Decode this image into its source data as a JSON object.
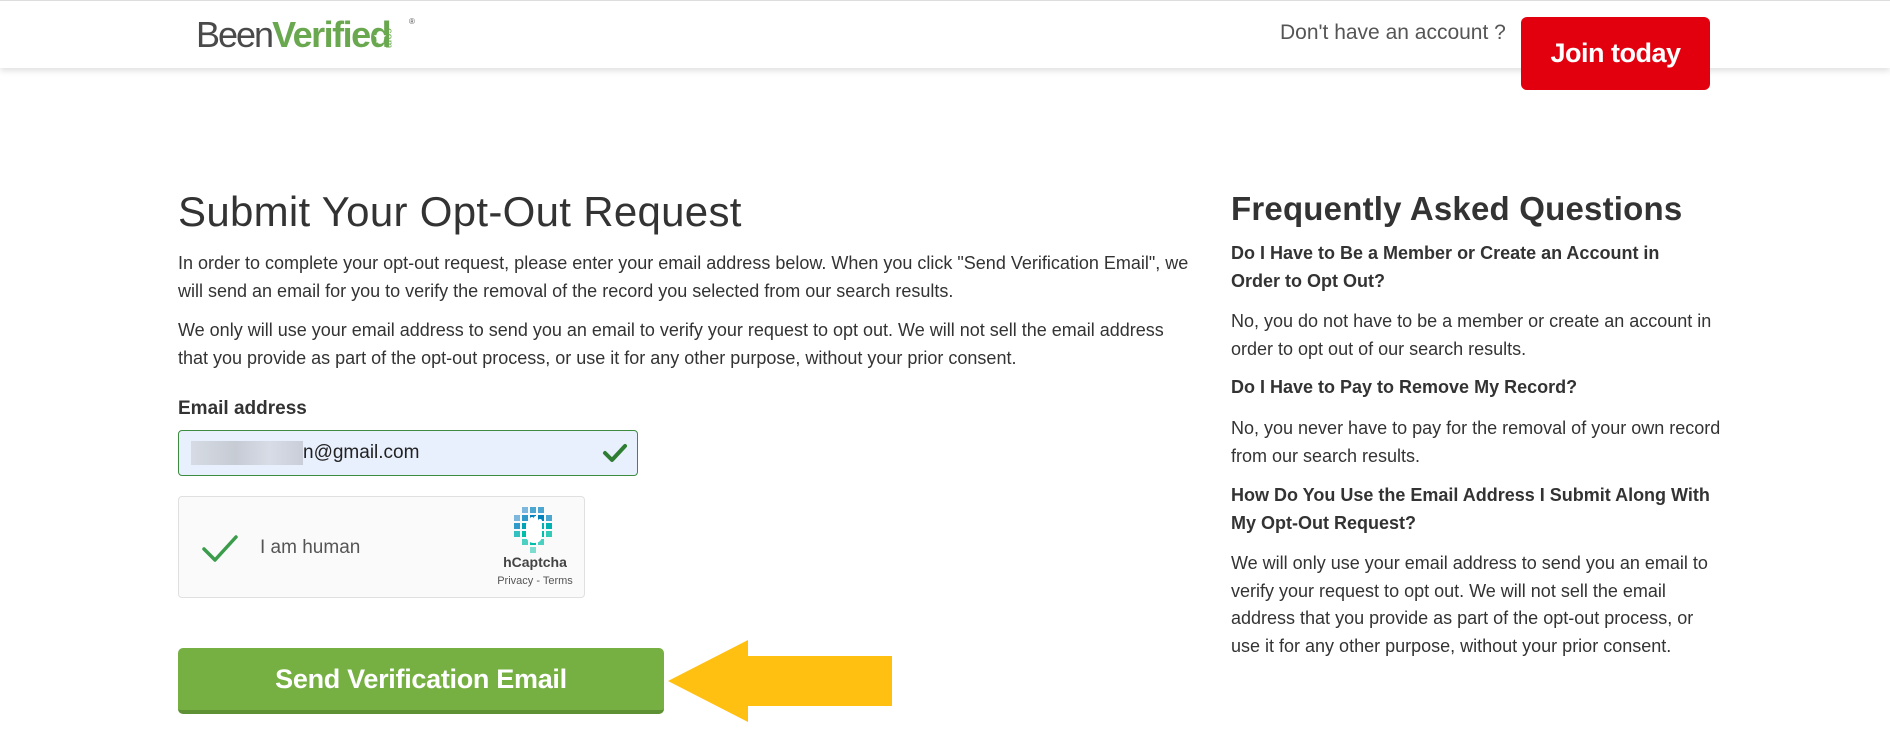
{
  "header": {
    "logo_been": "Been",
    "logo_verified": "Verified",
    "logo_dotcom": ".com",
    "logo_registered": "®",
    "no_account_text": "Don't have an account ?",
    "join_button": "Join today"
  },
  "form": {
    "title": "Submit Your Opt-Out Request",
    "paragraph1": "In order to complete your opt-out request, please enter your email address below. When you click \"Send Verification Email\", we will send an email for you to verify the removal of the record you selected from our search results.",
    "paragraph2": "We only will use your email address to send you an email to verify your request to opt out. We will not sell the email address that you provide as part of the opt-out process, or use it for any other purpose, without your prior consent.",
    "email_label": "Email address",
    "email_value_visible": "n@gmail.com",
    "captcha": {
      "label": "I am human",
      "brand": "hCaptcha",
      "links": "Privacy - Terms",
      "checked": true
    },
    "submit_button": "Send Verification Email"
  },
  "faq": {
    "title": "Frequently Asked Questions",
    "items": [
      {
        "question": "Do I Have to Be a Member or Create an Account in Order to Opt Out?",
        "answer": "No, you do not have to be a member or create an account in order to opt out of our search results."
      },
      {
        "question": "Do I Have to Pay to Remove My Record?",
        "answer": "No, you never have to pay for the removal of your own record from our search results."
      },
      {
        "question": "How Do You Use the Email Address I Submit Along With My Opt-Out Request?",
        "answer": "We will only use your email address to send you an email to verify your request to opt out. We will not sell the email address that you provide as part of the opt-out process, or use it for any other purpose, without your prior consent."
      }
    ]
  },
  "colors": {
    "brand_green": "#6aa84f",
    "join_red": "#e2000f",
    "submit_green": "#76b043",
    "arrow_yellow": "#ffc012"
  },
  "icons": {
    "email_valid": "checkmark-icon",
    "captcha_check": "checkmark-icon",
    "captcha_logo": "hcaptcha-logo-icon",
    "pointer": "left-arrow-icon"
  }
}
